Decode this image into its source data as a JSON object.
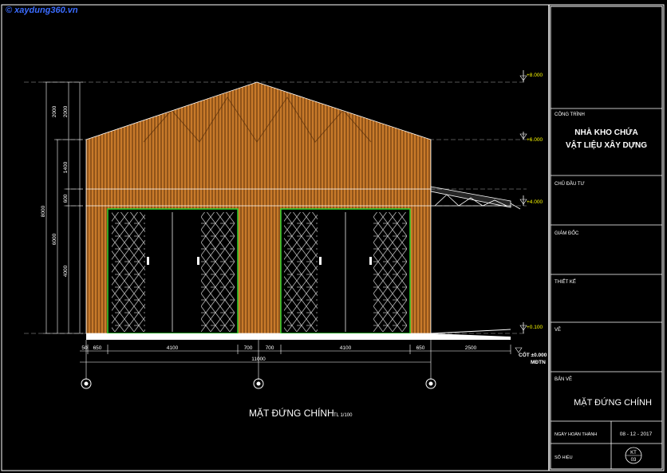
{
  "watermark": "© xaydung360.vn",
  "elevation_title": "MẶT ĐỨNG CHÍNH",
  "elevation_scale": "TL 1/100",
  "levels": [
    "+8.000",
    "+6.000",
    "+4.000",
    "+0.100"
  ],
  "ground_level": "CỐT ±0.000",
  "ground_sub": "MĐTN",
  "dims_bottom": [
    "50",
    "650",
    "4100",
    "700",
    "700",
    "4100",
    "650",
    "2500"
  ],
  "dim_total": "11000",
  "dims_left_outer": [
    "2000",
    "1400",
    "600",
    "4000"
  ],
  "dims_left_inner": [
    "2000",
    "6000"
  ],
  "dim_left_total": "8000",
  "title_block": {
    "project_label": "CÔNG TRÌNH",
    "project_name_1": "NHÀ KHO CHỨA",
    "project_name_2": "VẬT LIỆU XÂY DỰNG",
    "owner_label": "CHỦ ĐẦU TƯ",
    "director_label": "GIÁM ĐỐC",
    "design_label": "THIẾT KẾ",
    "draw_label": "VẼ",
    "sheet_label": "BẢN VẼ",
    "sheet_name": "MẶT ĐỨNG CHÍNH",
    "date_label": "NGÀY HOÀN THÀNH",
    "date_value": "08 - 12 - 2017",
    "number_label": "SỐ HIỆU",
    "number_code_1": "KT",
    "number_code_2": "03"
  },
  "colors": {
    "background": "#000000",
    "wall": "#c87a2a",
    "wall_line": "#5a2e08",
    "door_frame": "#2ed12e",
    "lines": "#ffffff",
    "accent_text": "#ffff00"
  }
}
